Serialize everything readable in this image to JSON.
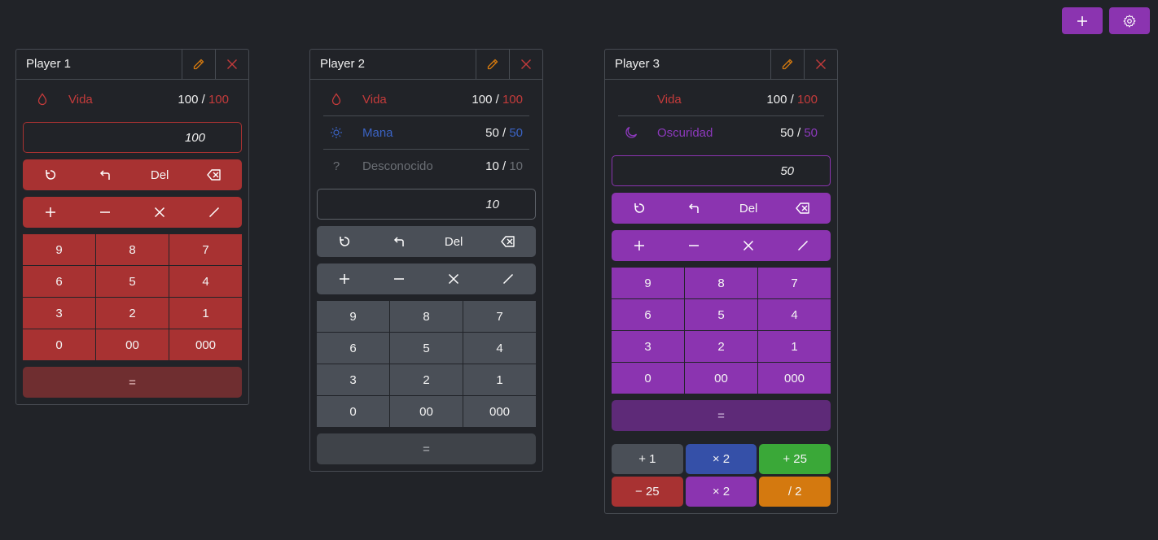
{
  "toolbar": {
    "add_icon": "plus-icon",
    "settings_icon": "gear-icon"
  },
  "colors": {
    "red": "#a83232",
    "gray": "#4a4f57",
    "purple": "#8b34b0",
    "blue": "#3550a8",
    "green": "#3aa838",
    "orange": "#d4790f",
    "vida": "#c43b3b",
    "mana": "#3b63c4",
    "oscuridad": "#8d39bd",
    "unknown": "#6b6f75"
  },
  "players": [
    {
      "name": "Player 1",
      "stats": [
        {
          "name": "Vida",
          "icon": "drop-icon",
          "current": "100",
          "max": "100"
        }
      ],
      "display": "100",
      "controls": [
        "reset",
        "undo",
        "Del",
        "backspace"
      ],
      "ops": [
        "+",
        "−",
        "×",
        "/"
      ],
      "keys": [
        "9",
        "8",
        "7",
        "6",
        "5",
        "4",
        "3",
        "2",
        "1",
        "0",
        "00",
        "000"
      ],
      "equals": "="
    },
    {
      "name": "Player 2",
      "stats": [
        {
          "name": "Vida",
          "icon": "drop-icon",
          "current": "100",
          "max": "100"
        },
        {
          "name": "Mana",
          "icon": "sun-icon",
          "current": "50",
          "max": "50"
        },
        {
          "name": "Desconocido",
          "icon": "question-icon",
          "current": "10",
          "max": "10"
        }
      ],
      "display": "10",
      "controls": [
        "reset",
        "undo",
        "Del",
        "backspace"
      ],
      "ops": [
        "+",
        "−",
        "×",
        "/"
      ],
      "keys": [
        "9",
        "8",
        "7",
        "6",
        "5",
        "4",
        "3",
        "2",
        "1",
        "0",
        "00",
        "000"
      ],
      "equals": "="
    },
    {
      "name": "Player 3",
      "stats": [
        {
          "name": "Vida",
          "icon": "none",
          "current": "100",
          "max": "100"
        },
        {
          "name": "Oscuridad",
          "icon": "moon-icon",
          "current": "50",
          "max": "50"
        }
      ],
      "display": "50",
      "controls": [
        "reset",
        "undo",
        "Del",
        "backspace"
      ],
      "ops": [
        "+",
        "−",
        "×",
        "/"
      ],
      "keys": [
        "9",
        "8",
        "7",
        "6",
        "5",
        "4",
        "3",
        "2",
        "1",
        "0",
        "00",
        "000"
      ],
      "equals": "=",
      "quick": [
        {
          "label": "+ 1",
          "color": "gray"
        },
        {
          "label": "× 2",
          "color": "blue"
        },
        {
          "label": "+ 25",
          "color": "green"
        },
        {
          "label": "− 25",
          "color": "red"
        },
        {
          "label": "× 2",
          "color": "purple"
        },
        {
          "label": "/ 2",
          "color": "orange"
        }
      ]
    }
  ]
}
